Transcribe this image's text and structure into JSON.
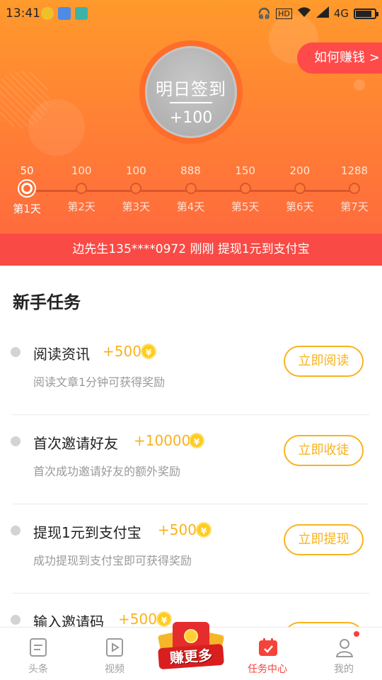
{
  "status_bar": {
    "time": "13:41",
    "hd": "HD",
    "network": "4G",
    "icons": [
      "app-notification-icon",
      "message-icon",
      "scan-icon",
      "headphone-icon",
      "wifi-icon",
      "signal-icon",
      "battery-icon"
    ]
  },
  "checkin": {
    "title": "明日签到",
    "bonus": "+100",
    "how_to_earn": "如何赚钱 >"
  },
  "days": [
    {
      "points": "50",
      "label": "第1天",
      "active": true
    },
    {
      "points": "100",
      "label": "第2天",
      "active": false
    },
    {
      "points": "100",
      "label": "第3天",
      "active": false
    },
    {
      "points": "888",
      "label": "第4天",
      "active": false
    },
    {
      "points": "150",
      "label": "第5天",
      "active": false
    },
    {
      "points": "200",
      "label": "第6天",
      "active": false
    },
    {
      "points": "1288",
      "label": "第7天",
      "active": false
    }
  ],
  "marquee": "边先生135****0972  刚刚  提现1元到支付宝",
  "tasks_section": {
    "title": "新手任务",
    "tasks": [
      {
        "name": "阅读资讯",
        "reward": "+500",
        "desc": "阅读文章1分钟可获得奖励",
        "action": "立即阅读"
      },
      {
        "name": "首次邀请好友",
        "reward": "+10000",
        "desc": "首次成功邀请好友的额外奖励",
        "action": "立即收徒"
      },
      {
        "name": "提现1元到支付宝",
        "reward": "+500",
        "desc": "成功提现到支付宝即可获得奖励",
        "action": "立即提现"
      },
      {
        "name": "输入邀请码",
        "reward": "+500",
        "desc": "",
        "action": ""
      }
    ]
  },
  "coin_symbol": "¥",
  "promo": "赚更多",
  "nav": {
    "items": [
      {
        "label": "头条",
        "icon": "news-icon"
      },
      {
        "label": "视频",
        "icon": "video-icon"
      },
      {
        "label": "",
        "icon": "red-packet-icon"
      },
      {
        "label": "任务中心",
        "icon": "calendar-icon"
      },
      {
        "label": "我的",
        "icon": "profile-icon"
      }
    ]
  },
  "colors": {
    "accent_orange": "#ff8433",
    "red": "#f94a45",
    "gold": "#f8b31e",
    "nav_active": "#f5433a"
  }
}
